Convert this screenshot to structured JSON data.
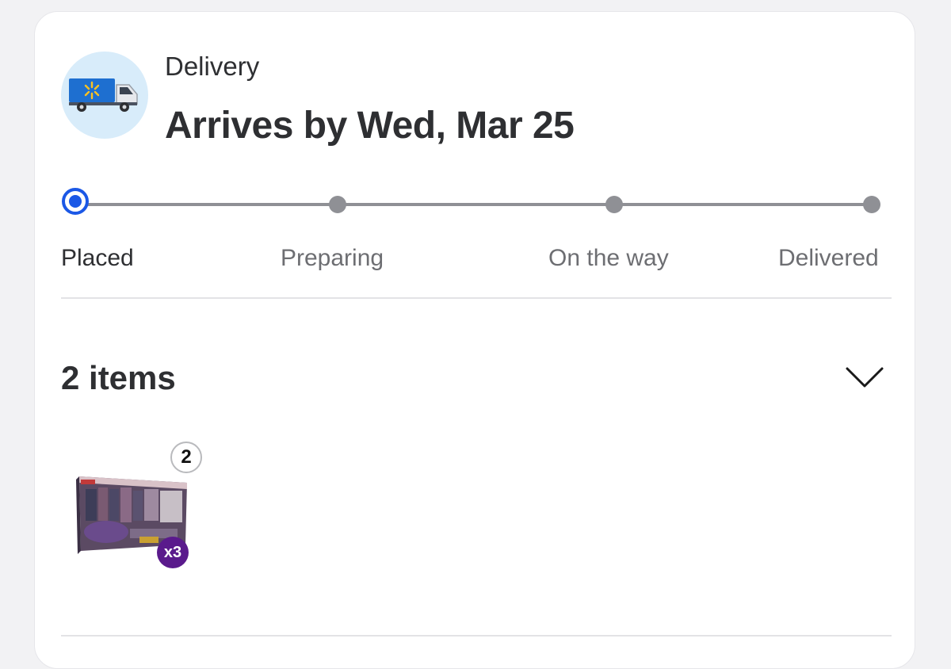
{
  "delivery": {
    "method_label": "Delivery",
    "arrival_text": "Arrives by Wed, Mar 25",
    "icon": "delivery-truck-icon"
  },
  "tracker": {
    "steps": [
      {
        "label": "Placed",
        "status": "active"
      },
      {
        "label": "Preparing",
        "status": "pending"
      },
      {
        "label": "On the way",
        "status": "pending"
      },
      {
        "label": "Delivered",
        "status": "pending"
      }
    ],
    "active_color": "#1b58e6",
    "pending_color": "#8f9095"
  },
  "items_section": {
    "heading": "2 items",
    "toggle_icon": "chevron-down-icon",
    "item": {
      "quantity_badge": "2",
      "multipack_badge": "x3"
    }
  }
}
